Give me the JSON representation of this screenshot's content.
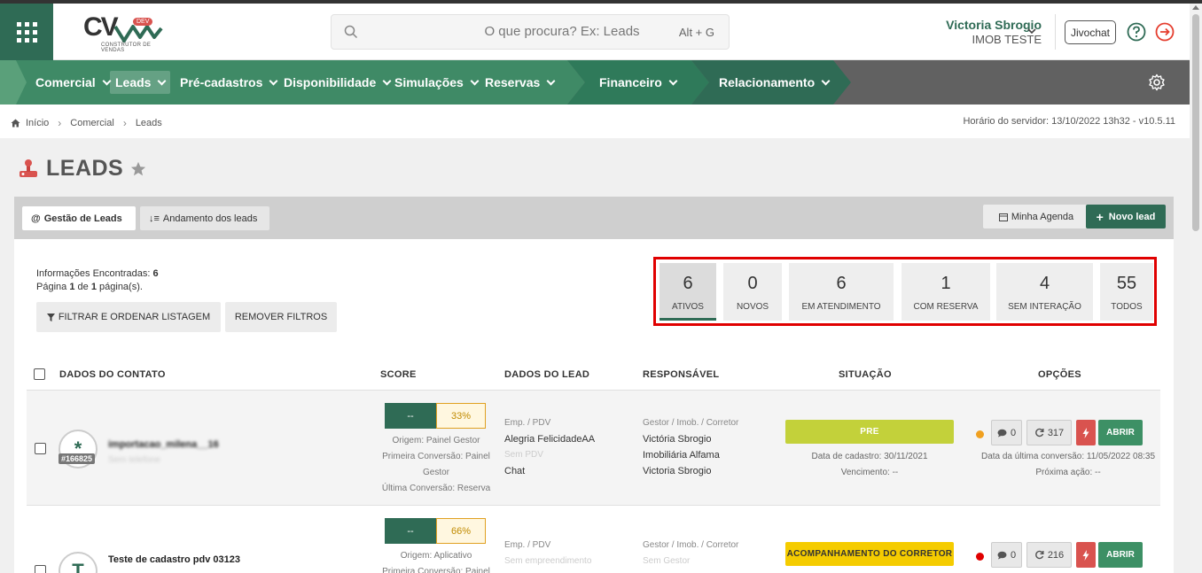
{
  "header": {
    "logo_text": "CV",
    "logo_badge": "DEV",
    "logo_sub": "CONSTRUTOR DE VENDAS",
    "search_placeholder": "O que procura? Ex: Leads",
    "search_shortcut": "Alt + G",
    "user_name": "Victoria Sbrogio",
    "user_company": "IMOB TESTE",
    "jivochat": "Jivochat",
    "colors": {
      "brand": "#2f6b55",
      "alert": "#d9534f"
    }
  },
  "nav": {
    "items": [
      {
        "label": "Comercial"
      },
      {
        "label": "Leads"
      },
      {
        "label": "Pré-cadastros"
      },
      {
        "label": "Disponibilidade"
      },
      {
        "label": "Simulações"
      },
      {
        "label": "Reservas"
      },
      {
        "label": "Financeiro"
      },
      {
        "label": "Relacionamento"
      }
    ],
    "active": "Leads"
  },
  "breadcrumb": {
    "items": [
      "Início",
      "Comercial",
      "Leads"
    ],
    "server_time": "Horário do servidor: 13/10/2022 13h32 - v10.5.11"
  },
  "page": {
    "title": "LEADS",
    "tabs": [
      {
        "label": "Gestão de Leads",
        "icon": "at-icon"
      },
      {
        "label": "Andamento dos leads",
        "icon": "sort-icon"
      }
    ],
    "agenda_label": "Minha Agenda",
    "new_lead_label": "Novo lead",
    "info_found_label": "Informações Encontradas:",
    "info_found_value": "6",
    "info_page_prefix": "Página",
    "info_page_current": "1",
    "info_page_mid": "de",
    "info_page_total": "1",
    "info_page_suffix": "página(s).",
    "filter_label": "FILTRAR E ORDENAR LISTAGEM",
    "remove_filters_label": "REMOVER FILTROS"
  },
  "stats": [
    {
      "value": "6",
      "label": "ATIVOS"
    },
    {
      "value": "0",
      "label": "NOVOS"
    },
    {
      "value": "6",
      "label": "EM ATENDIMENTO"
    },
    {
      "value": "1",
      "label": "COM RESERVA"
    },
    {
      "value": "4",
      "label": "SEM INTERAÇÃO"
    },
    {
      "value": "55",
      "label": "TODOS"
    }
  ],
  "table": {
    "headers": {
      "contact": "DADOS DO CONTATO",
      "score": "SCORE",
      "lead": "DADOS DO LEAD",
      "responsible": "RESPONSÁVEL",
      "status": "SITUAÇÃO",
      "options": "OPÇÕES"
    },
    "rows": [
      {
        "avatar": "*",
        "id": "#166825",
        "name": "importacao_milena__16",
        "phone": "Sem telefone",
        "score_left": "--",
        "score_pct": "33%",
        "origin": "Origem: Painel Gestor",
        "first_conv": "Primeira Conversão: Painel Gestor",
        "last_conv": "Última Conversão: Reserva",
        "emp_label": "Emp. / PDV",
        "emp": "Alegria FelicidadeAA",
        "pdv": "Sem PDV",
        "channel": "Chat",
        "resp_label": "Gestor / Imob. / Corretor",
        "gestor": "Victória Sbrogio",
        "imob": "Imobiliária Alfama",
        "corretor": "Victoria Sbrogio",
        "status": "PRE",
        "status_color": "#c3d13a",
        "created": "Data de cadastro: 30/11/2021",
        "due": "Vencimento: --",
        "dot_color": "#f0a020",
        "comments": "0",
        "interactions": "317",
        "open": "ABRIR",
        "last_conversion": "Data da última conversão: 11/05/2022 08:35",
        "next_action": "Próxima ação: --"
      },
      {
        "avatar": "T",
        "name": "Teste de cadastro pdv 03123",
        "score_left": "--",
        "score_pct": "66%",
        "origin": "Origem: Aplicativo",
        "first_conv": "Primeira Conversão: Painel",
        "emp_label": "Emp. / PDV",
        "emp": "Sem empreendimento",
        "resp_label": "Gestor / Imob. / Corretor",
        "gestor": "Sem Gestor",
        "status": "ACOMPANHAMENTO DO CORRETOR",
        "status_color": "#f5cc00",
        "dot_color": "#e00000",
        "comments": "0",
        "interactions": "216",
        "open": "ABRIR"
      }
    ]
  }
}
